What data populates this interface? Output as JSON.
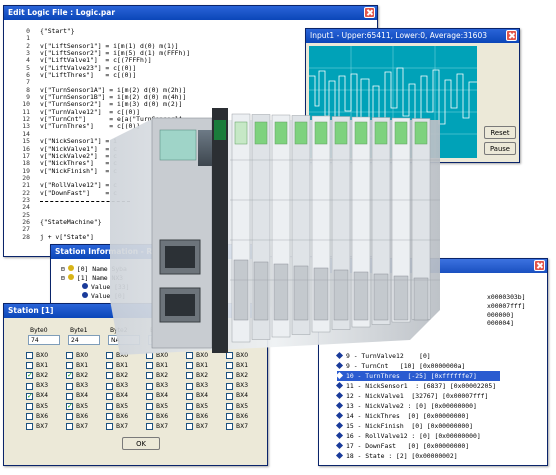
{
  "logic_window": {
    "title": "Edit Logic File : Logic.par",
    "line_numbers": [
      "0",
      "1",
      "2",
      "3",
      "4",
      "5",
      "6",
      "7",
      "8",
      "9",
      "10",
      "11",
      "12",
      "13",
      "14",
      "15",
      "16",
      "17",
      "18",
      "19",
      "20",
      "21",
      "22",
      "23",
      "24",
      "25",
      "26",
      "27",
      "28"
    ],
    "code_lines": [
      "{\"Start\"}",
      "",
      "v[\"LiftSensor1\"] = i[m(1) d(0) m(1)]",
      "v[\"LiftSensor2\"] = i[m(5) d(1) m(FFFh)]",
      "v[\"LiftValve1\"]  = c[(7FFFh)]",
      "v[\"LiftValve23\"] = c[(0)]",
      "v[\"LiftThres\"]   = c[(0)]",
      "",
      "v[\"TurnSensor1A\"] = i[m(2) d(0) m(2h)]",
      "v[\"TurnSensor1B\"] = i[m(2) d(0) m(4h)]",
      "v[\"TurnSensor2\"]  = i[m(3) d(0) m(2)]",
      "v[\"TurnValve12\"]  = c[(0)]",
      "v[\"TurnCnt\"]      = e[a(\"TurnSensor1A",
      "v[\"TurnThres\"]    = c[(0)]",
      "",
      "v[\"NickSensor1\"] = i",
      "v[\"NickValve1\"]  = c",
      "v[\"NickValve2\"]  = c",
      "v[\"NickThres\"]   = c",
      "v[\"NickFinish\"]  = c",
      "",
      "v[\"RollValve12\"] = c",
      "v[\"DownFast\"]    = c",
      "",
      "",
      "",
      "{\"StateMachine\"}",
      "",
      "j + v[\"State\"]"
    ]
  },
  "input_window": {
    "title": "Input1 - Upper:65411, Lower:0, Average:31603",
    "buttons": {
      "reset": "Reset",
      "pause": "Pause"
    }
  },
  "station_info_window": {
    "title": "Station Information - Rem",
    "rows": [
      {
        "expander": "⊟",
        "text": "[0]  Name Syba"
      },
      {
        "expander": "⊟",
        "text": "[1]  Name NX3"
      },
      {
        "expander": "",
        "text": "Value [33]"
      },
      {
        "expander": "",
        "text": "Value [0]"
      }
    ]
  },
  "station1_window": {
    "title": "Station [1]",
    "columns": [
      {
        "header": "Byte0",
        "value": "74",
        "bits": [
          "BX0",
          "BX1",
          "BX2",
          "BX3",
          "BX4",
          "BX5",
          "BX6",
          "BX7"
        ],
        "checked": [
          false,
          false,
          true,
          false,
          true,
          false,
          false,
          false
        ]
      },
      {
        "header": "Byte1",
        "value": "24",
        "bits": [
          "BX0",
          "BX1",
          "BX2",
          "BX3",
          "BX4",
          "BX5",
          "BX6",
          "BX7"
        ],
        "checked": [
          false,
          false,
          true,
          false,
          false,
          true,
          false,
          false
        ]
      },
      {
        "header": "Byte2",
        "value": "NA",
        "bits": [
          "BX0",
          "BX1",
          "BX2",
          "BX3",
          "BX4",
          "BX5",
          "BX6",
          "BX7"
        ],
        "checked": [
          false,
          false,
          false,
          false,
          false,
          false,
          false,
          false
        ]
      },
      {
        "header": "Byte3",
        "value": "NA",
        "bits": [
          "BX0",
          "BX1",
          "BX2",
          "BX3",
          "BX4",
          "BX5",
          "BX6",
          "BX7"
        ],
        "checked": [
          false,
          false,
          false,
          false,
          false,
          false,
          false,
          false
        ]
      },
      {
        "header": "",
        "value": "",
        "bits": [
          "BX0",
          "BX1",
          "BX2",
          "BX3",
          "BX4",
          "BX5",
          "BX6",
          "BX7"
        ],
        "checked": [
          false,
          false,
          false,
          false,
          false,
          false,
          false,
          false
        ]
      },
      {
        "header": "",
        "value": "",
        "bits": [
          "BX0",
          "BX1",
          "BX2",
          "BX3",
          "BX4",
          "BX5",
          "BX6",
          "BX7"
        ],
        "checked": [
          false,
          false,
          false,
          false,
          false,
          false,
          false,
          false
        ]
      }
    ],
    "ok_label": "OK"
  },
  "variables_window": {
    "right_values": [
      "x0000303b]",
      "x00007fff]",
      "000000]",
      "000004]"
    ],
    "rows": [
      {
        "text": "9 - TurnValve12    [0]",
        "selected": false
      },
      {
        "text": "9 - TurnCnt   [10] [0x0000000a]",
        "selected": false
      },
      {
        "text": "10 - TurnThres  [-25] [0xffffffe7]",
        "selected": true
      },
      {
        "text": "11 - NickSensor1  : [6837] [0x00002205]",
        "selected": false
      },
      {
        "text": "12 - NickValve1  [32767] [0x00007fff]",
        "selected": false
      },
      {
        "text": "13 - NickValve2 : [0] [0x00000000]",
        "selected": false
      },
      {
        "text": "14 - NickThres  [0] [0x00000000]",
        "selected": false
      },
      {
        "text": "15 - NickFinish  [0] [0x00000000]",
        "selected": false
      },
      {
        "text": "16 - RollValve12 : [0] [0x00000000]",
        "selected": false
      },
      {
        "text": "17 - DownFast   [0] [0x00000000]",
        "selected": false
      },
      {
        "text": "18 - State : [2] [0x00000002]",
        "selected": false
      }
    ]
  },
  "colors": {
    "titlebar": "#0b46b8",
    "graph_bg": "#00a2b8",
    "selection": "#2a5bd0",
    "module_green": "#7ed27e"
  },
  "icons": {
    "close": "close-icon",
    "tree": "tree-icon",
    "node": "diamond-icon"
  }
}
